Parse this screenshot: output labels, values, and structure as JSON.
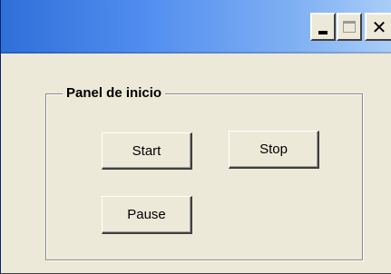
{
  "window": {
    "controls": {
      "minimize_icon": "minimize-icon",
      "maximize_icon": "maximize-icon",
      "close_icon": "close-icon",
      "close_glyph": "✕"
    }
  },
  "panel": {
    "title": "Panel de inicio",
    "buttons": {
      "start": "Start",
      "stop": "Stop",
      "pause": "Pause"
    }
  }
}
